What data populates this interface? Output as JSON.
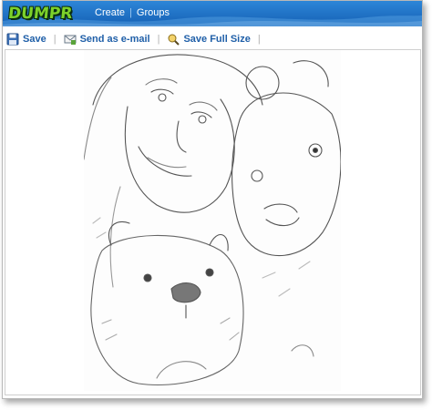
{
  "app": {
    "logo_text": "DUMPR"
  },
  "nav": {
    "items": [
      {
        "label": "Create"
      },
      {
        "label": "Groups"
      }
    ],
    "separator": "|"
  },
  "toolbar": {
    "separator": "|",
    "save_label": "Save",
    "email_label": "Send as e-mail",
    "fullsize_label": "Save Full Size",
    "save_icon": "floppy-disk-icon",
    "email_icon": "envelope-icon",
    "fullsize_icon": "magnifier-icon"
  },
  "image": {
    "subject": "pencil-sketch-photo"
  },
  "colors": {
    "header_blue": "#1f73c7",
    "link_blue": "#1f5fa8",
    "logo_green": "#7cd12a"
  }
}
